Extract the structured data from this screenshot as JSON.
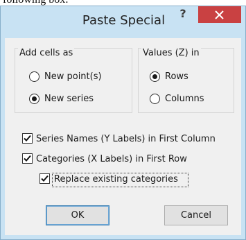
{
  "background_text": "following box:",
  "dialog": {
    "title": "Paste Special",
    "help_label": "?",
    "close_icon": "close-icon",
    "add_cells_as": {
      "legend": "Add cells as",
      "new_points": "New point(s)",
      "new_series": "New series",
      "selected": "New series"
    },
    "values_in": {
      "legend": "Values (Z) in",
      "rows": "Rows",
      "columns": "Columns",
      "selected": "Rows"
    },
    "checkboxes": {
      "series_names": "Series Names (Y Labels) in First Column",
      "categories": "Categories (X Labels) in First Row",
      "replace_categories": "Replace existing categories",
      "series_names_checked": true,
      "categories_checked": true,
      "replace_categories_checked": true
    },
    "buttons": {
      "ok": "OK",
      "cancel": "Cancel"
    }
  }
}
